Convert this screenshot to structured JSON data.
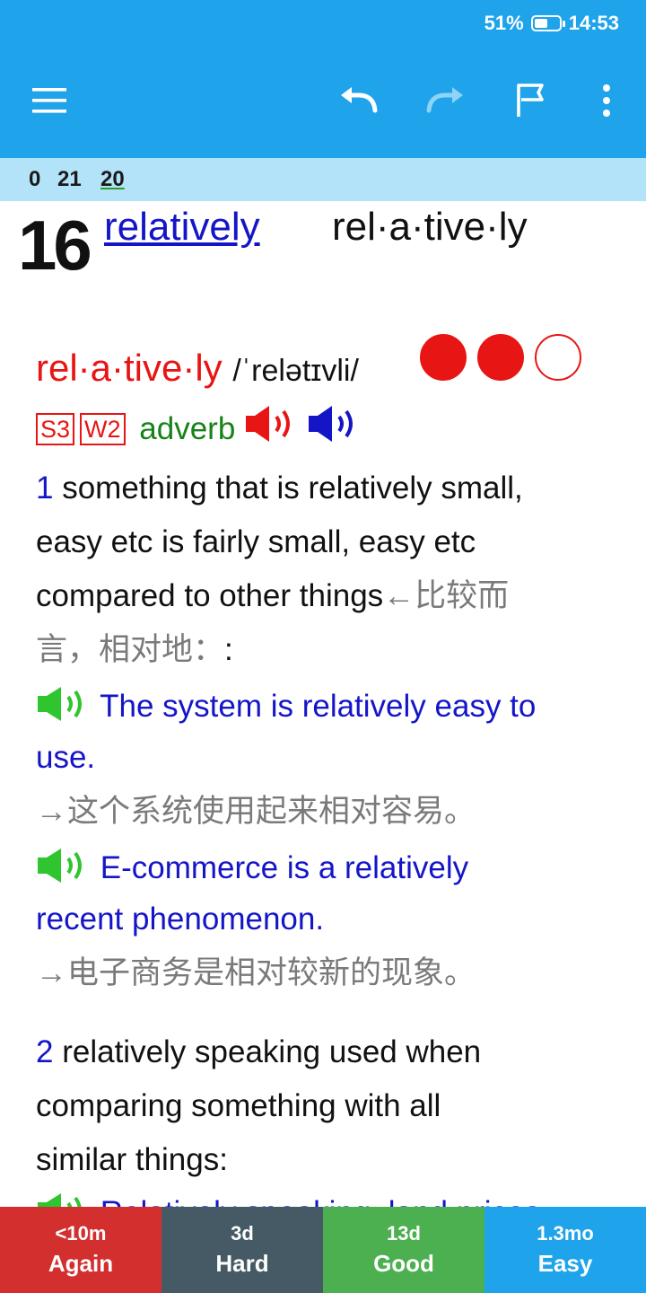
{
  "status_bar": {
    "battery": "51%",
    "time": "14:53"
  },
  "toolbar": {
    "icons": [
      "menu-icon",
      "undo-icon",
      "redo-icon",
      "flag-icon",
      "more-vert-icon"
    ]
  },
  "counters": {
    "new": "0",
    "learning": "21",
    "review": "20"
  },
  "card": {
    "big_number": "16",
    "headword_link": "relatively ",
    "headword_syllables": "rel·a·tive·ly",
    "entry_word": "rel·a·tive·ly",
    "pronunciation": "/ˈrelətɪvli/",
    "freq_badges": [
      "S3",
      "W2"
    ],
    "part_of_speech": "adverb",
    "sense1_num": "1",
    "sense1_line1": "something that is relatively small,",
    "sense1_line2": "easy etc is fairly small, easy etc",
    "sense1_line3_en": "compared to other things",
    "sense1_line3_zh": "←比较而",
    "sense1_line4": "言，相对地：",
    "sense1_line4_end": ":",
    "ex1_en_line1": "The system is relatively easy to",
    "ex1_en_line2": "use.",
    "ex1_zh": "→这个系统使用起来相对容易。",
    "ex2_en_line1": "E-commerce is a relatively",
    "ex2_en_line2": "recent phenomenon.",
    "ex2_zh": "→电子商务是相对较新的现象。",
    "sense2_num": "2",
    "sense2_line1": "relatively speaking used when",
    "sense2_line2": "comparing something with all",
    "sense2_line3": "similar things:",
    "ex3_partial": "Relatively speaking, land prices"
  },
  "answer_buttons": [
    {
      "interval": "<10m",
      "label": "Again",
      "color": "#d32f2f"
    },
    {
      "interval": "3d",
      "label": "Hard",
      "color": "#455a64"
    },
    {
      "interval": "13d",
      "label": "Good",
      "color": "#4caf50"
    },
    {
      "interval": "1.3mo",
      "label": "Easy",
      "color": "#1fa3eb"
    }
  ]
}
